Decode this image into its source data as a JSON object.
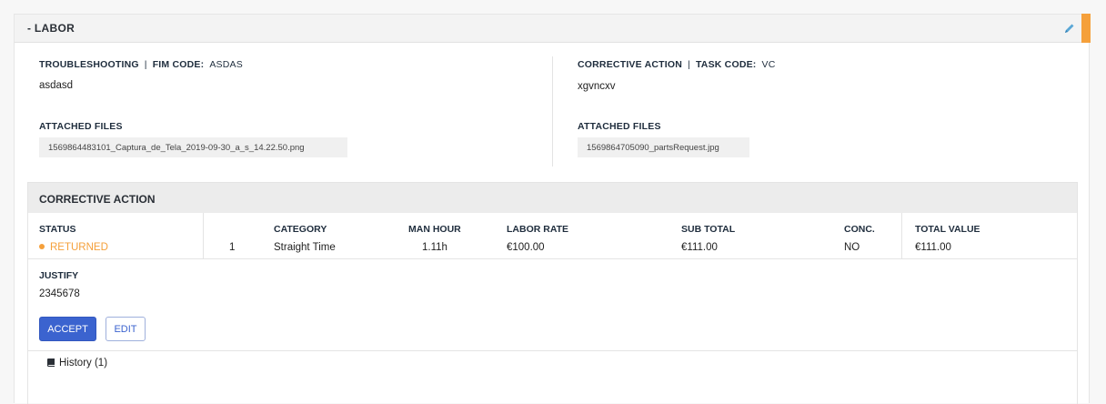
{
  "panel": {
    "title": "- LABOR",
    "accent_color": "#f5a03b",
    "edit_icon": "pencil-icon"
  },
  "troubleshooting": {
    "label": "TROUBLESHOOTING",
    "separator": "|",
    "code_label": "FIM CODE:",
    "code_value": "ASDAS",
    "text": "asdasd",
    "files_label": "ATTACHED FILES",
    "files": [
      "1569864483101_Captura_de_Tela_2019-09-30_a_s_14.22.50.png"
    ]
  },
  "corrective": {
    "label": "CORRECTIVE ACTION",
    "separator": "|",
    "code_label": "TASK CODE:",
    "code_value": "VC",
    "text": "xgvncxv",
    "files_label": "ATTACHED FILES",
    "files": [
      "1569864705090_partsRequest.jpg"
    ]
  },
  "corrective_action": {
    "title": "CORRECTIVE ACTION",
    "columns": {
      "status": "STATUS",
      "category": "CATEGORY",
      "man_hour": "MAN HOUR",
      "labor_rate": "LABOR RATE",
      "sub_total": "SUB TOTAL",
      "conc": "CONC.",
      "total_value": "TOTAL VALUE"
    },
    "row": {
      "status": "RETURNED",
      "status_color": "#f5a03b",
      "qty": "1",
      "category": "Straight Time",
      "man_hour": "1.11h",
      "labor_rate": "€100.00",
      "sub_total": "€111.00",
      "conc": "NO",
      "total_value": "€111.00"
    },
    "justify_label": "JUSTIFY",
    "justify_value": "2345678",
    "accept_label": "ACCEPT",
    "edit_label": "EDIT",
    "history_label": "History (1)",
    "history_icon": "book-icon"
  }
}
